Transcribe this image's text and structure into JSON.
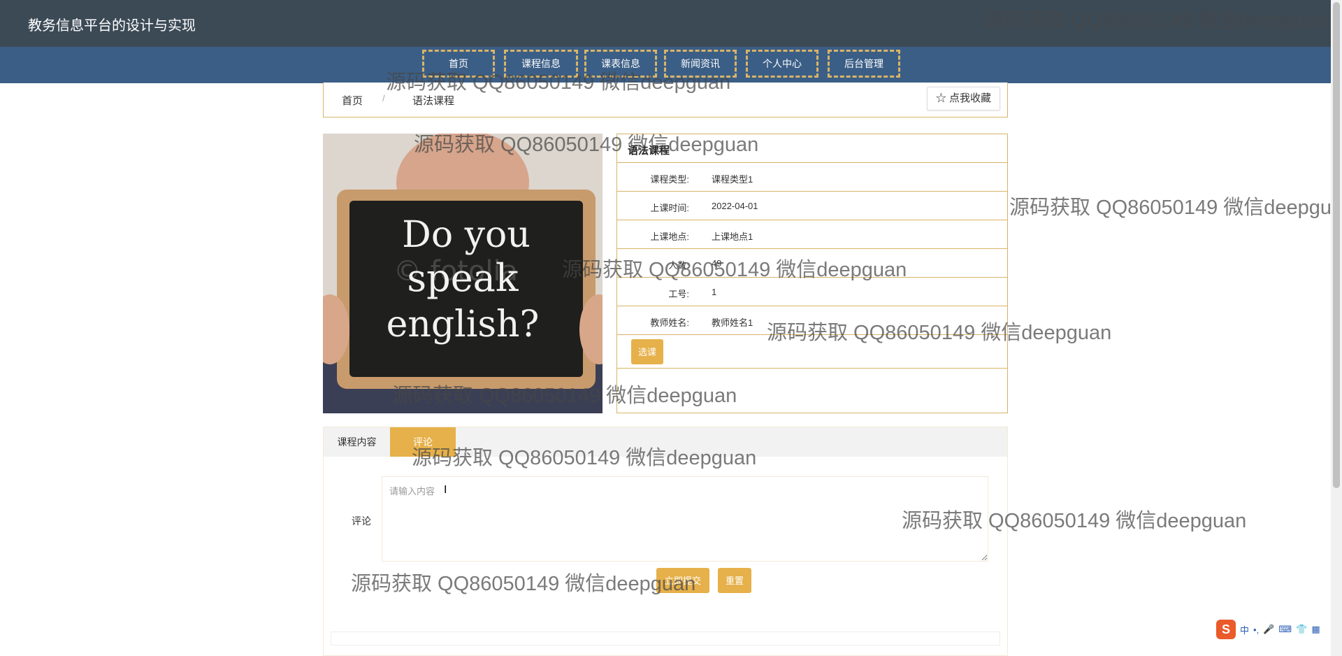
{
  "header": {
    "title": "教务信息平台的设计与实现"
  },
  "nav": {
    "items": [
      "首页",
      "课程信息",
      "课表信息",
      "新闻资讯",
      "个人中心",
      "后台管理"
    ]
  },
  "breadcrumb": {
    "home": "首页",
    "separator": "/",
    "current": "语法课程"
  },
  "favorite_button": "☆ 点我收藏",
  "course": {
    "name": "语法课程",
    "image_text": "Do you speak english?",
    "image_watermark": "© fotolia",
    "fields": [
      {
        "label": "课程类型:",
        "value": "课程类型1"
      },
      {
        "label": "上课时间:",
        "value": "2022-04-01"
      },
      {
        "label": "上课地点:",
        "value": "上课地点1"
      },
      {
        "label": "人数:",
        "value": "49"
      },
      {
        "label": "工号:",
        "value": "1"
      },
      {
        "label": "教师姓名:",
        "value": "教师姓名1"
      }
    ],
    "select_button": "选课"
  },
  "tabs": {
    "content_label": "课程内容",
    "comment_label": "评论"
  },
  "comment_form": {
    "label": "评论",
    "placeholder": "请输入内容",
    "submit_label": "立即提交",
    "reset_label": "重置"
  },
  "watermark_text": "源码获取 QQ86050149 微信deepguan",
  "ime": {
    "logo": "S",
    "items": [
      "中",
      "•,",
      "🎤",
      "⌨",
      "👕",
      "▦"
    ]
  },
  "colors": {
    "topbar": "#3c4a56",
    "navbar": "#3b5e86",
    "accent": "#e6b04a",
    "border": "#d8b468"
  }
}
